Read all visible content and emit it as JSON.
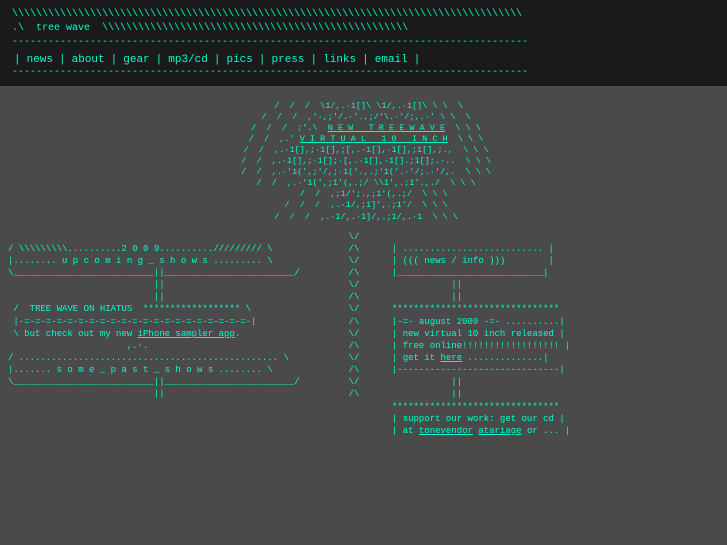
{
  "header": {
    "art_line1": "\\ \\ \\ \\ \\ \\ \\ \\ \\ \\ \\ \\ \\ \\ \\ \\ \\ \\ \\ \\ \\ \\ \\ \\ \\ \\ \\ \\ \\ \\ \\ \\ \\ \\ \\ \\ \\ \\ \\ \\",
    "art_line2": ".\\  tree wave  \\ \\ \\ \\ \\ \\ \\ \\ \\ \\ \\ \\ \\ \\ \\ \\ \\ \\ \\ \\ \\ \\ \\ \\ \\",
    "divider1": "----------------------------------------------------------------------",
    "nav_pipe1": "|",
    "nav_news": "news",
    "nav_about": "about",
    "nav_gear": "gear",
    "nav_mp3cd": "mp3/cd",
    "nav_pics": "pics",
    "nav_press": "press",
    "nav_links": "links",
    "nav_email": "email",
    "divider2": "----------------------------------------------------------------------"
  },
  "ascii_art": {
    "lines": [
      "  /  /  /  \\1/,.·1[]\\ \\1/,.·1[]\\ \\ \\  \\",
      " /  /  /'·,;'/.·'.,.;/\\';.·'/;,.·' \\ \\  \\",
      " /  /  /  ;'.\\  N E W   T R E E W A V E  \\ \\ \\",
      " /  /  ,.'   V I R T U A L   1 0   I N C H  \\ \\ \\",
      " /  /  ,.·1[],;·1[],;[,.·1[],·1[],;1[],;.,  \\ \\ \\",
      " /  /  ,.·1[],;·1[];·[,.·1[],·1[].;1[];.·..  \\ \\ \\",
      " /  /  ,.·'1(',;'/,;·1('.,.;'1('.·';/;.·'/,.  \\ \\ \\",
      " /  /  ,.·'1(',;1'(,.;/ \\\\1',.;1'.,./ \\  \\ \\ \\",
      "  /  /  ,;1/';.,;1'(,.;  \\  \\ \\",
      " /  /  /  ,.·1/,;1]',.;1'/ \\ \\ \\",
      " /  /  /  ,.·1/,.·1]/,.;1/,.·1 \\ \\ \\"
    ]
  },
  "left_panel": {
    "upcoming_header": "/ \\\\\\\\\\\\\\\\..........2 0 0 9..........///////// \\",
    "upcoming_label": "|........ u p c o m i n g _ s h o w s ......... \\",
    "upcoming_close": "\\____________________________||____________________________/",
    "upcoming_spacer": "                              ||",
    "upcoming_spacer2": "                              ||",
    "hiatus_line": " /  TREE WAVE ON HIATUS  ****************** \\",
    "hiatus_sub": " |-=-=-=-=-=-=-=-=-=-=-=-=-=-=-=-=-=-=-=-=-=-|",
    "iphone_line": " \\ but check out my new",
    "iphone_link_text": "iPhone sampler app",
    "iphone_end": ".",
    "spacer": "                         ,..·.",
    "past_header": "/ ................................................ \\",
    "past_label": "|....... s o m e _ p a s t _ s h o w s ........ \\",
    "past_close": "\\____________________________||____________________________/",
    "past_spacer": "                              ||"
  },
  "center_dividers": [
    "\\/",
    "/\\",
    "\\/",
    "/\\",
    "\\/",
    "/\\",
    "\\/",
    "/\\",
    "\\/",
    "/\\",
    "\\/",
    "/\\"
  ],
  "right_panel": {
    "info_header": " | .......................... |",
    "info_label": " | ((( news / info )))       |",
    "info_close": " |__________________________|",
    "info_spacer": "                    ||",
    "info_spacer2": "                    ||",
    "stars": " *******************************",
    "aug_line": " |-=- august 2009 -=- ..........|",
    "virtual_line": " | new virtual 10 inch released |",
    "free_line": " | free online!!!!!!!!!!!!!!!!!! |",
    "get_line": " | get it",
    "here_link": "here",
    "here_end": " ..............|",
    "dash_line": " |------------------------------|",
    "spacer": "                    ||",
    "spacer2": "                    ||",
    "stars2": " *******************************",
    "support_line": " | support our work: get our cd |",
    "vendor_line": " | at",
    "vendor_link1": "tonevendor",
    "vendor_sep": ",",
    "vendor_link2": "atariage",
    "vendor_end": "or ... |"
  }
}
